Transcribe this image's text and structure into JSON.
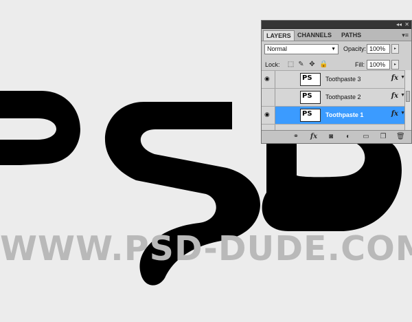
{
  "canvas": {
    "watermark": "WWW.PSD-DUDE.COM"
  },
  "panel": {
    "tabs": [
      {
        "label": "LAYERS",
        "active": true
      },
      {
        "label": "CHANNELS",
        "active": false
      },
      {
        "label": "PATHS",
        "active": false
      }
    ],
    "blend_mode": "Normal",
    "opacity_label": "Opacity:",
    "opacity_value": "100%",
    "lock_label": "Lock:",
    "fill_label": "Fill:",
    "fill_value": "100%",
    "layers": [
      {
        "name": "Toothpaste 3",
        "selected": false,
        "thumb_text": "PS"
      },
      {
        "name": "Toothpaste 2",
        "selected": false,
        "thumb_text": "PS"
      },
      {
        "name": "Toothpaste 1",
        "selected": true,
        "thumb_text": "PS"
      }
    ],
    "fx_label": "fx",
    "bottom_fx_label": "fx"
  },
  "colors": {
    "selection": "#3b9bff",
    "panel_bg": "#cfcfcf",
    "canvas_bg": "#ececec",
    "shape": "#000000",
    "watermark": "#b9b9b9"
  }
}
